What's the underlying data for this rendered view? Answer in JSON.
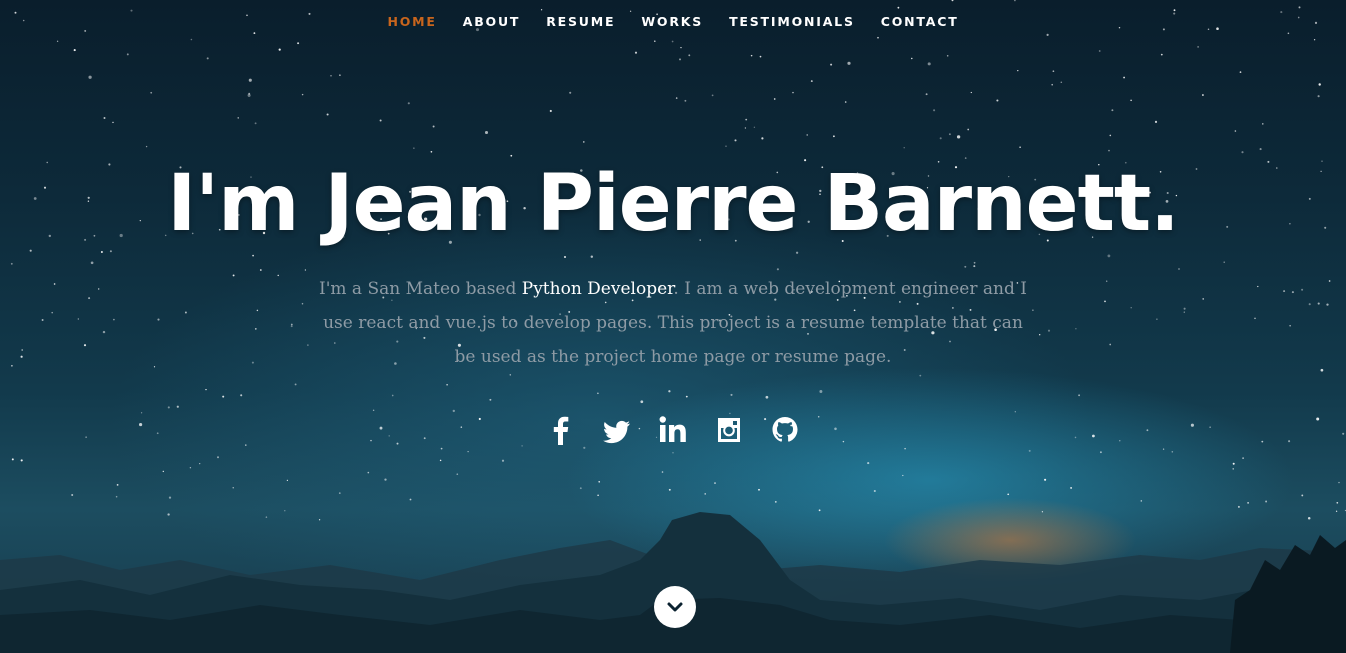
{
  "nav": {
    "items": [
      {
        "label": "HOME",
        "active": true
      },
      {
        "label": "ABOUT",
        "active": false
      },
      {
        "label": "RESUME",
        "active": false
      },
      {
        "label": "WORKS",
        "active": false
      },
      {
        "label": "TESTIMONIALS",
        "active": false
      },
      {
        "label": "CONTACT",
        "active": false
      }
    ],
    "active_color": "#c8651d",
    "text_color": "#ffffff"
  },
  "hero": {
    "headline": "I'm Jean Pierre Barnett.",
    "intro_prefix": "I'm a San Mateo based ",
    "intro_highlight": "Python Developer",
    "intro_suffix": ". I am a web development engineer and I use react and vue.js to develop pages. This project is a resume template that can be used as the project home page or resume page."
  },
  "social": [
    {
      "name": "facebook-icon"
    },
    {
      "name": "twitter-icon"
    },
    {
      "name": "linkedin-icon"
    },
    {
      "name": "instagram-icon"
    },
    {
      "name": "github-icon"
    }
  ],
  "scroll_down": {
    "icon": "chevron-down-icon"
  }
}
